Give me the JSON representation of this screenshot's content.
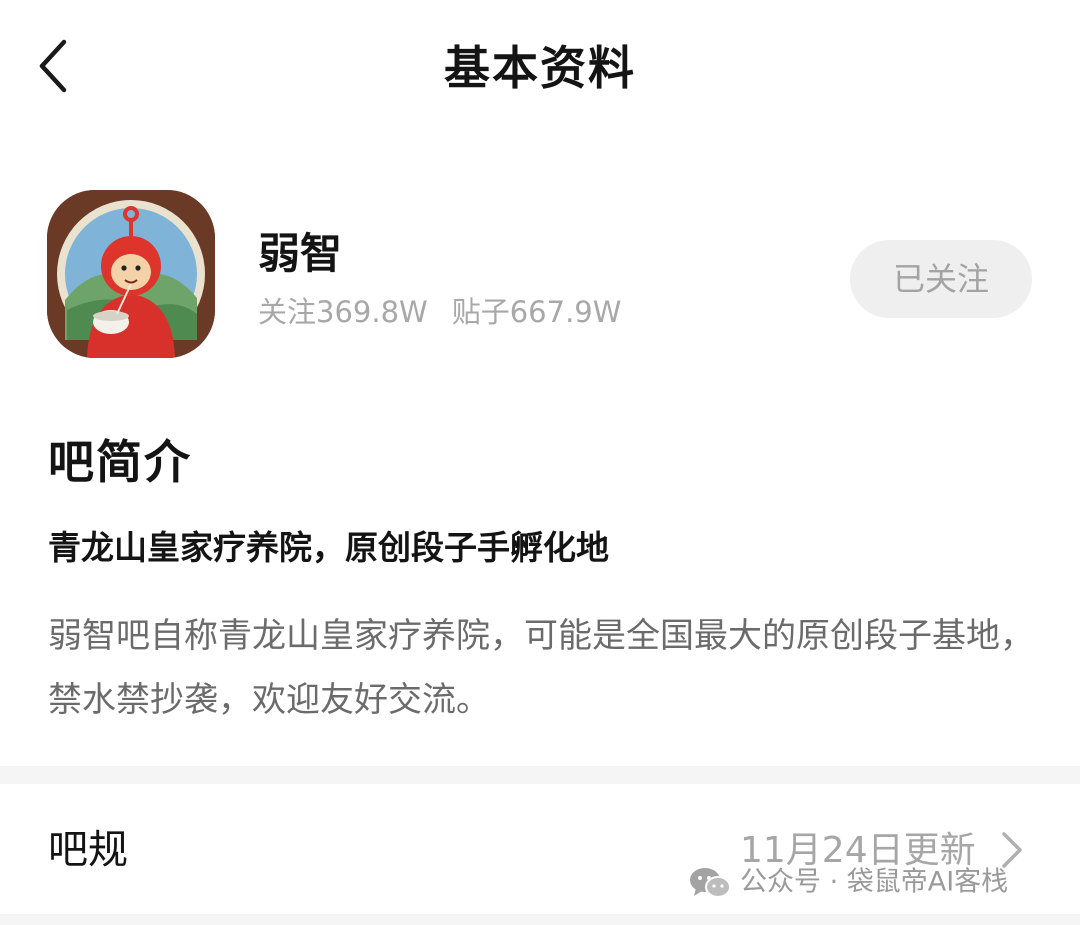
{
  "header": {
    "title": "基本资料",
    "back_icon": "chevron-left-icon"
  },
  "profile": {
    "avatar_icon": "avatar-teletubby-po",
    "name": "弱智",
    "followers_label": "关注",
    "followers_value": "369.8W",
    "posts_label": "贴子",
    "posts_value": "667.9W",
    "follow_button": "已关注"
  },
  "intro": {
    "heading": "吧简介",
    "subtitle": "青龙山皇家疗养院，原创段子手孵化地",
    "text": "弱智吧自称青龙山皇家疗养院，可能是全国最大的原创段子基地，禁水禁抄袭，欢迎友好交流。"
  },
  "rules": {
    "label": "吧规",
    "updated": "11月24日更新",
    "chevron_icon": "chevron-right-icon"
  },
  "watermark": {
    "icon": "wechat-icon",
    "text": "公众号 · 袋鼠帝AI客栈"
  },
  "colors": {
    "text_primary": "#141414",
    "text_secondary": "#a8a8a8",
    "button_bg": "#efefef",
    "divider": "#f5f5f5"
  }
}
